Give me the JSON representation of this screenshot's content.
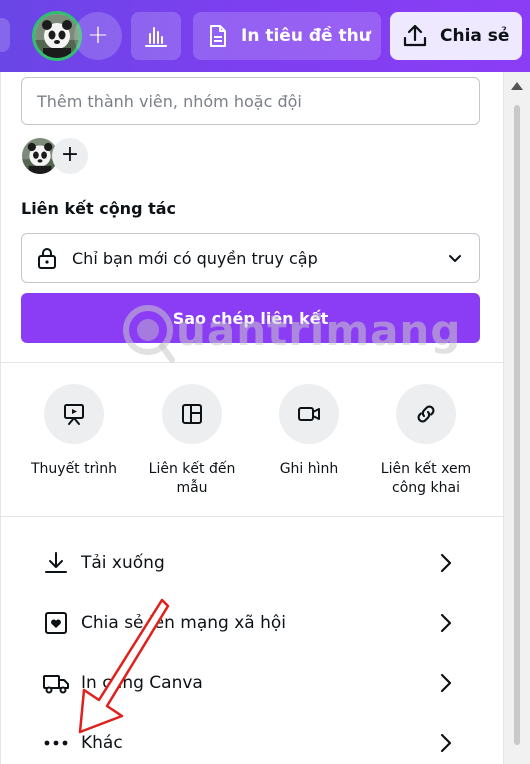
{
  "toolbar": {
    "print_label": "In tiêu đề thư",
    "share_label": "Chia sẻ",
    "add_symbol": "+"
  },
  "share_panel": {
    "member_placeholder": "Thêm thành viên, nhóm hoặc đội",
    "add_symbol": "+",
    "collab_link_title": "Liên kết cộng tác",
    "access_value": "Chỉ bạn mới có quyền truy cập",
    "copy_link_label": "Sao chép liên kết",
    "options": [
      {
        "label": "Thuyết trình",
        "icon": "presentation-icon"
      },
      {
        "label": "Liên kết đến mẫu",
        "icon": "template-icon"
      },
      {
        "label": "Ghi hình",
        "icon": "video-camera-icon"
      },
      {
        "label": "Liên kết xem công khai",
        "icon": "link-icon"
      }
    ],
    "rows": [
      {
        "label": "Tải xuống",
        "icon": "download-icon"
      },
      {
        "label": "Chia sẻ lên mạng xã hội",
        "icon": "heart-box-icon"
      },
      {
        "label": "In cùng Canva",
        "icon": "truck-icon"
      },
      {
        "label": "Khác",
        "icon": "more-dots-icon"
      }
    ]
  },
  "watermark": {
    "text": "uantrimang"
  },
  "colors": {
    "toolbar_start": "#6a46e6",
    "toolbar_end": "#8b3df5",
    "primary_button": "#8b3df5",
    "share_button_bg": "#efe9ff",
    "arrow": "#e0201b"
  }
}
